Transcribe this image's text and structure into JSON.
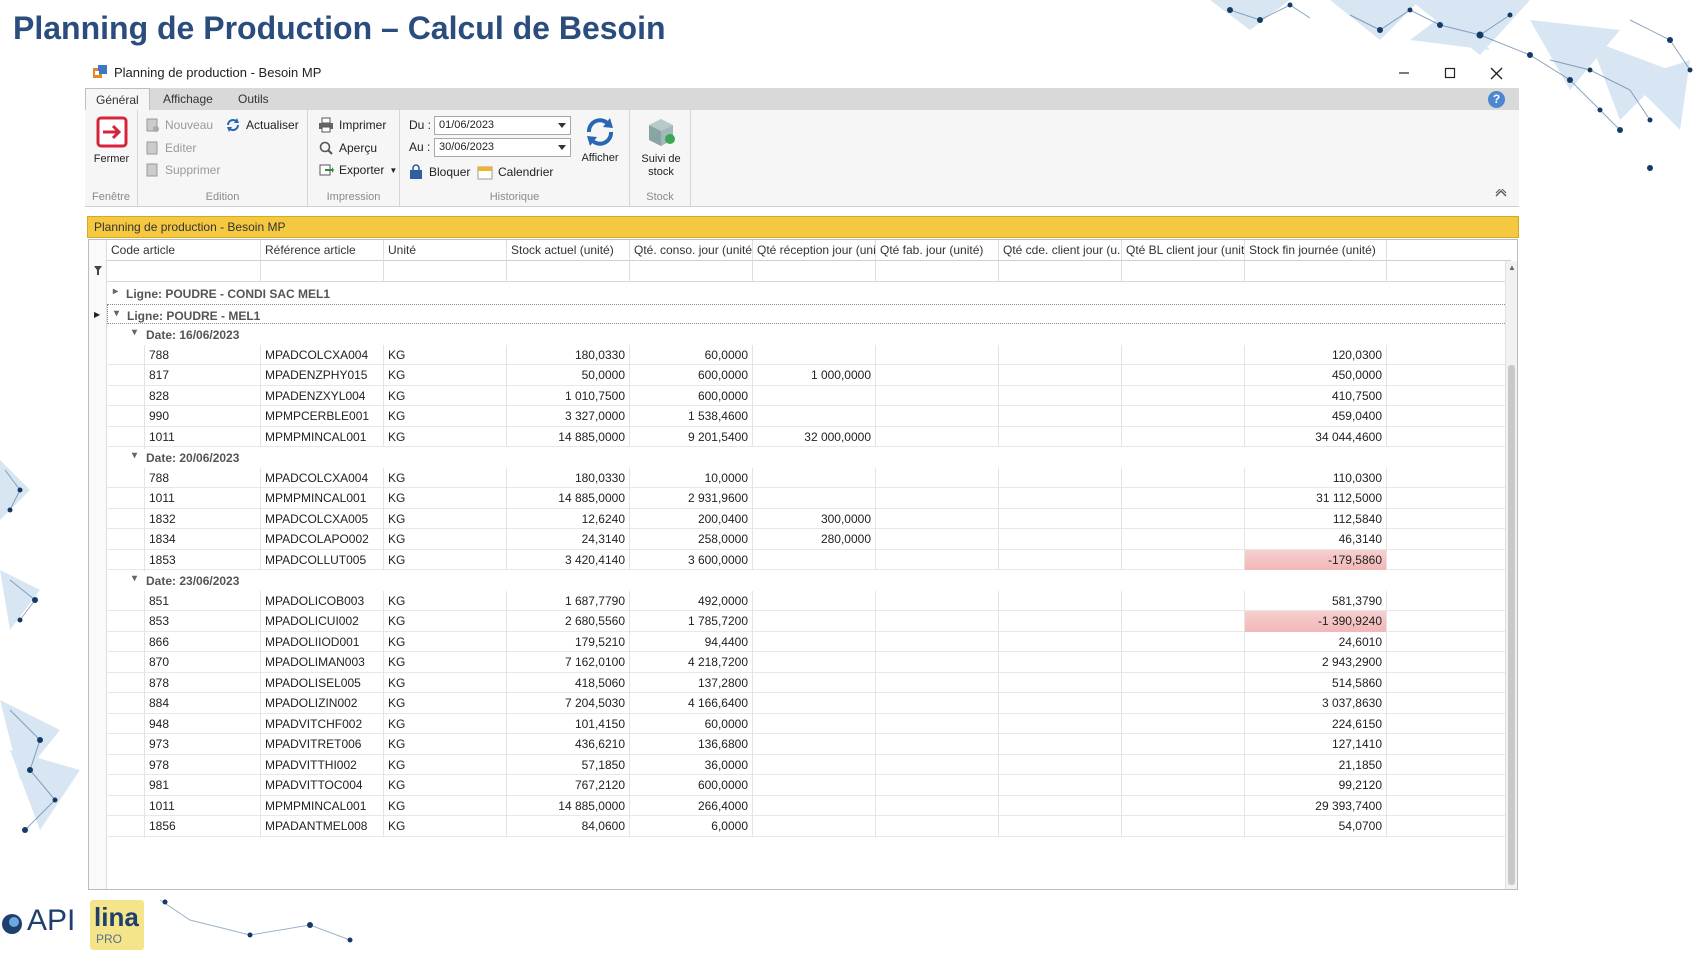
{
  "slide": {
    "title": "Planning de Production – Calcul de Besoin"
  },
  "window": {
    "title": "Planning de production - Besoin MP"
  },
  "ribbon": {
    "tabs": [
      "Général",
      "Affichage",
      "Outils"
    ],
    "active_tab": "Général",
    "groups": {
      "fenetre": {
        "label": "Fenêtre",
        "close_label": "Fermer"
      },
      "edition": {
        "label": "Edition",
        "new_label": "Nouveau",
        "refresh_label": "Actualiser",
        "edit_label": "Editer",
        "delete_label": "Supprimer"
      },
      "impression": {
        "label": "Impression",
        "print_label": "Imprimer",
        "preview_label": "Aperçu",
        "export_label": "Exporter"
      },
      "historique": {
        "label": "Historique",
        "from_label": "Du :",
        "from_value": "01/06/2023",
        "to_label": "Au :",
        "to_value": "30/06/2023",
        "block_label": "Bloquer",
        "calendar_label": "Calendrier",
        "show_label": "Afficher"
      },
      "stock": {
        "label": "Stock",
        "follow_label_1": "Suivi de",
        "follow_label_2": "stock"
      }
    }
  },
  "panel": {
    "title": "Planning de production - Besoin MP"
  },
  "grid": {
    "columns": [
      "Code article",
      "Référence article",
      "Unité",
      "Stock actuel (unité)",
      "Qté. conso. jour (unité)",
      "Qté réception jour (uni...",
      "Qté fab. jour (unité)",
      "Qté cde. client jour (u...",
      "Qté BL client jour (unité)",
      "Stock fin journée (unité)"
    ],
    "groups": [
      {
        "label": "Ligne: POUDRE - CONDI SAC MEL1",
        "expanded": false
      },
      {
        "label": "Ligne: POUDRE - MEL1",
        "expanded": true
      }
    ],
    "dates": [
      {
        "label": "Date: 16/06/2023",
        "rows": [
          [
            "788",
            "MPADCOLCXA004",
            "KG",
            "180,0330",
            "60,0000",
            "",
            "",
            "",
            "",
            "120,0300"
          ],
          [
            "817",
            "MPADENZPHY015",
            "KG",
            "50,0000",
            "600,0000",
            "1 000,0000",
            "",
            "",
            "",
            "450,0000"
          ],
          [
            "828",
            "MPADENZXYL004",
            "KG",
            "1 010,7500",
            "600,0000",
            "",
            "",
            "",
            "",
            "410,7500"
          ],
          [
            "990",
            "MPMPCERBLE001",
            "KG",
            "3 327,0000",
            "1 538,4600",
            "",
            "",
            "",
            "",
            "459,0400"
          ],
          [
            "1011",
            "MPMPMINCAL001",
            "KG",
            "14 885,0000",
            "9 201,5400",
            "32 000,0000",
            "",
            "",
            "",
            "34 044,4600"
          ]
        ]
      },
      {
        "label": "Date: 20/06/2023",
        "rows": [
          [
            "788",
            "MPADCOLCXA004",
            "KG",
            "180,0330",
            "10,0000",
            "",
            "",
            "",
            "",
            "110,0300"
          ],
          [
            "1011",
            "MPMPMINCAL001",
            "KG",
            "14 885,0000",
            "2 931,9600",
            "",
            "",
            "",
            "",
            "31 112,5000"
          ],
          [
            "1832",
            "MPADCOLCXA005",
            "KG",
            "12,6240",
            "200,0400",
            "300,0000",
            "",
            "",
            "",
            "112,5840"
          ],
          [
            "1834",
            "MPADCOLAPO002",
            "KG",
            "24,3140",
            "258,0000",
            "280,0000",
            "",
            "",
            "",
            "46,3140"
          ],
          [
            "1853",
            "MPADCOLLUT005",
            "KG",
            "3 420,4140",
            "3 600,0000",
            "",
            "",
            "",
            "",
            "-179,5860"
          ]
        ]
      },
      {
        "label": "Date: 23/06/2023",
        "rows": [
          [
            "851",
            "MPADOLICOB003",
            "KG",
            "1 687,7790",
            "492,0000",
            "",
            "",
            "",
            "",
            "581,3790"
          ],
          [
            "853",
            "MPADOLICUI002",
            "KG",
            "2 680,5560",
            "1 785,7200",
            "",
            "",
            "",
            "",
            "-1 390,9240"
          ],
          [
            "866",
            "MPADOLIIOD001",
            "KG",
            "179,5210",
            "94,4400",
            "",
            "",
            "",
            "",
            "24,6010"
          ],
          [
            "870",
            "MPADOLIMAN003",
            "KG",
            "7 162,0100",
            "4 218,7200",
            "",
            "",
            "",
            "",
            "2 943,2900"
          ],
          [
            "878",
            "MPADOLISEL005",
            "KG",
            "418,5060",
            "137,2800",
            "",
            "",
            "",
            "",
            "514,5860"
          ],
          [
            "884",
            "MPADOLIZIN002",
            "KG",
            "7 204,5030",
            "4 166,6400",
            "",
            "",
            "",
            "",
            "3 037,8630"
          ],
          [
            "948",
            "MPADVITCHF002",
            "KG",
            "101,4150",
            "60,0000",
            "",
            "",
            "",
            "",
            "224,6150"
          ],
          [
            "973",
            "MPADVITRET006",
            "KG",
            "436,6210",
            "136,6800",
            "",
            "",
            "",
            "",
            "127,1410"
          ],
          [
            "978",
            "MPADVITTHI002",
            "KG",
            "57,1850",
            "36,0000",
            "",
            "",
            "",
            "",
            "21,1850"
          ],
          [
            "981",
            "MPADVITTOC004",
            "KG",
            "767,2120",
            "600,0000",
            "",
            "",
            "",
            "",
            "99,2120"
          ],
          [
            "1011",
            "MPMPMINCAL001",
            "KG",
            "14 885,0000",
            "266,4000",
            "",
            "",
            "",
            "",
            "29 393,7400"
          ],
          [
            "1856",
            "MPADANTMEL008",
            "KG",
            "84,0600",
            "6,0000",
            "",
            "",
            "",
            "",
            "54,0700"
          ]
        ]
      }
    ]
  },
  "logos": {
    "api_text": "API",
    "lina_text": "lina",
    "lina_sub": "PRO"
  },
  "colors": {
    "title_blue": "#2a4d7e",
    "panel_header": "#f5c842",
    "negative_bg": "#f2b7b7"
  }
}
